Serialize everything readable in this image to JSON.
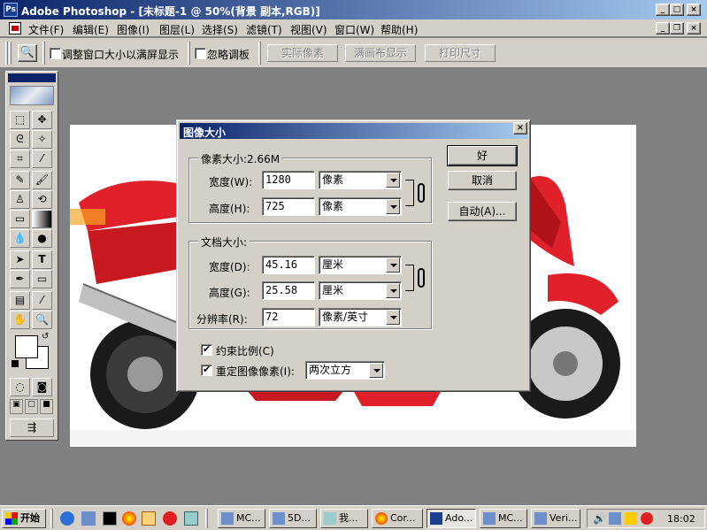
{
  "window": {
    "title": "Adobe Photoshop - [未标题-1 @ 50%(背景 副本,RGB)]"
  },
  "menu": [
    "文件(F)",
    "编辑(E)",
    "图像(I)",
    "图层(L)",
    "选择(S)",
    "滤镜(T)",
    "视图(V)",
    "窗口(W)",
    "帮助(H)"
  ],
  "options": {
    "resize_window_label": "调整窗口大小以满屏显示",
    "ignore_palettes_label": "忽略调板",
    "actual_pixels": "实际像素",
    "fit_on_screen": "满画布显示",
    "print_size": "打印尺寸"
  },
  "dialog": {
    "title": "图像大小",
    "pixel_dimensions": {
      "legend": "像素大小:2.66M",
      "width_label": "宽度(W):",
      "width_value": "1280",
      "width_unit": "像素",
      "height_label": "高度(H):",
      "height_value": "725",
      "height_unit": "像素"
    },
    "document_size": {
      "legend": "文档大小:",
      "width_label": "宽度(D):",
      "width_value": "45.16",
      "width_unit": "厘米",
      "height_label": "高度(G):",
      "height_value": "25.58",
      "height_unit": "厘米",
      "resolution_label": "分辨率(R):",
      "resolution_value": "72",
      "resolution_unit": "像素/英寸"
    },
    "constrain_label": "约束比例(C)",
    "constrain_checked": true,
    "resample_label": "重定图像像素(I):",
    "resample_checked": true,
    "resample_method": "两次立方",
    "ok": "好",
    "cancel": "取消",
    "auto": "自动(A)..."
  },
  "taskbar": {
    "start": "开始",
    "tasks": [
      "MC...",
      "5D...",
      "我...",
      "Cor...",
      "Ado...",
      "MC...",
      "Veri..."
    ],
    "clock": "18:02"
  },
  "colors": {
    "title_bar": "#0a246a",
    "face": "#d4d0c8",
    "workspace": "#808080",
    "moto_red": "#e0202a"
  }
}
